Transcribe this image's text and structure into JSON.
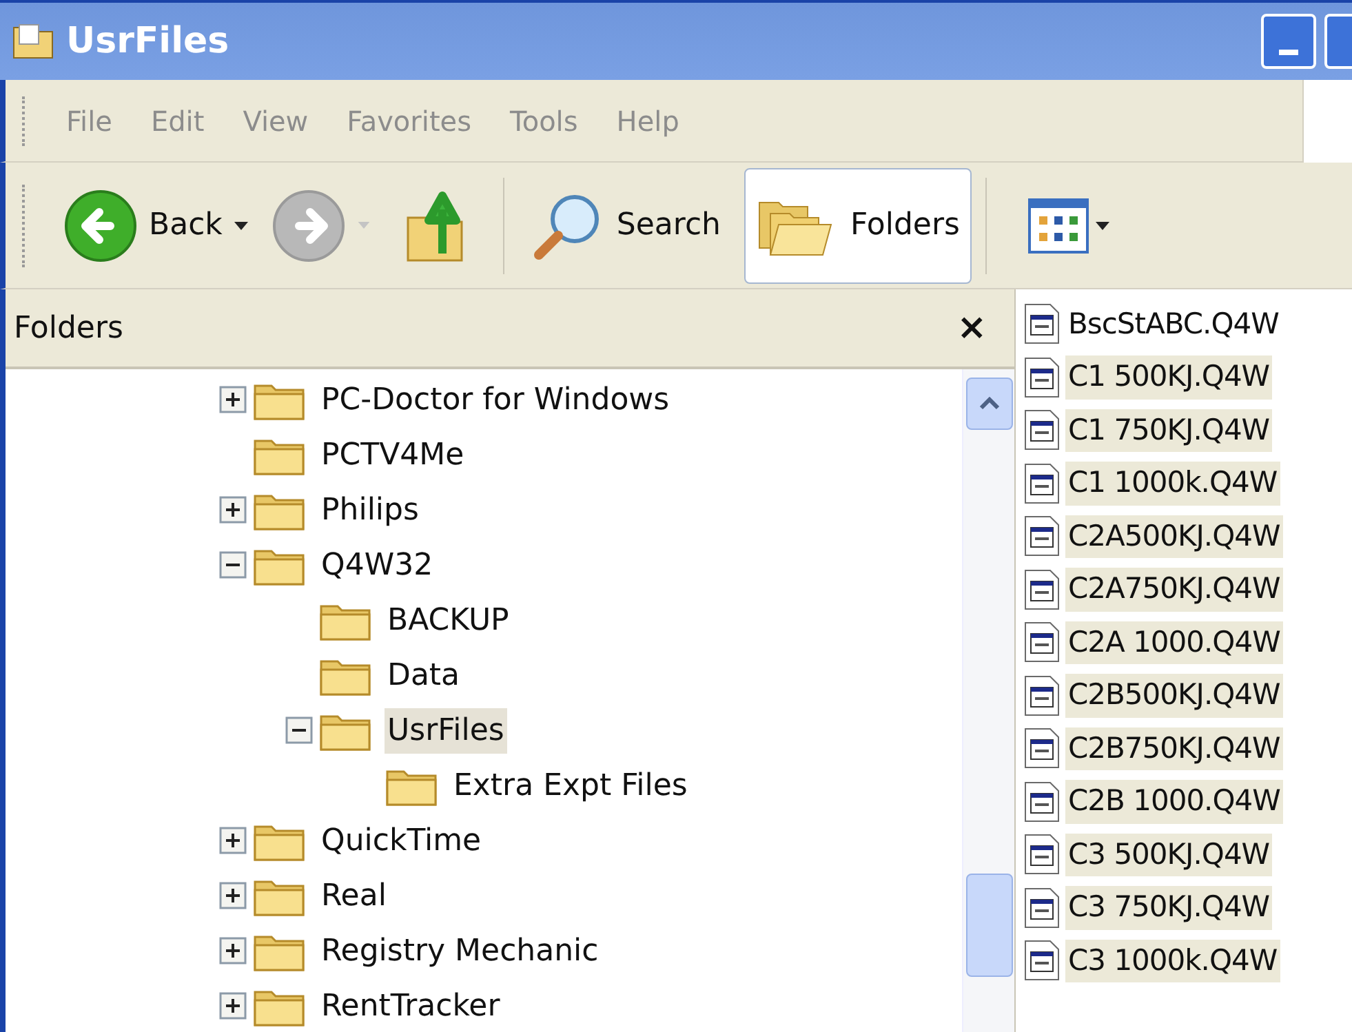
{
  "window": {
    "title": "UsrFiles"
  },
  "menu": [
    "File",
    "Edit",
    "View",
    "Favorites",
    "Tools",
    "Help"
  ],
  "toolbar": [
    {
      "kind": "back",
      "label": "Back",
      "disabled": false
    },
    {
      "kind": "forward",
      "disabled": true
    },
    {
      "kind": "up",
      "disabled": false
    },
    {
      "kind": "search",
      "label": "Search",
      "selected": false
    },
    {
      "kind": "folders",
      "label": "Folders",
      "selected": true
    },
    {
      "kind": "views",
      "disabled": false
    }
  ],
  "folders_pane": {
    "title": "Folders",
    "close": "×",
    "tree": [
      {
        "name": "PC-Doctor for Windows",
        "has_children": true,
        "expanded": false,
        "selected": false
      },
      {
        "name": "PCTV4Me",
        "has_children": false,
        "selected": false
      },
      {
        "name": "Philips",
        "has_children": true,
        "expanded": false,
        "selected": false
      },
      {
        "name": "Q4W32",
        "has_children": true,
        "expanded": true,
        "selected": false,
        "children": [
          {
            "name": "BACKUP",
            "has_children": false,
            "selected": false
          },
          {
            "name": "Data",
            "has_children": false,
            "selected": false
          },
          {
            "name": "UsrFiles",
            "has_children": true,
            "expanded": true,
            "selected": true,
            "children": [
              {
                "name": "Extra Expt Files",
                "has_children": false,
                "selected": false
              }
            ]
          }
        ]
      },
      {
        "name": "QuickTime",
        "has_children": true,
        "expanded": false,
        "selected": false
      },
      {
        "name": "Real",
        "has_children": true,
        "expanded": false,
        "selected": false
      },
      {
        "name": "Registry Mechanic",
        "has_children": true,
        "expanded": false,
        "selected": false
      },
      {
        "name": "RentTracker",
        "has_children": true,
        "expanded": false,
        "selected": false
      }
    ]
  },
  "files": [
    {
      "name": "BscStABC.Q4W",
      "selected": false
    },
    {
      "name": "C1 500KJ.Q4W",
      "selected": true
    },
    {
      "name": "C1 750KJ.Q4W",
      "selected": true
    },
    {
      "name": "C1 1000k.Q4W",
      "selected": true
    },
    {
      "name": "C2A500KJ.Q4W",
      "selected": true
    },
    {
      "name": "C2A750KJ.Q4W",
      "selected": true
    },
    {
      "name": "C2A 1000.Q4W",
      "selected": true
    },
    {
      "name": "C2B500KJ.Q4W",
      "selected": true
    },
    {
      "name": "C2B750KJ.Q4W",
      "selected": true
    },
    {
      "name": "C2B 1000.Q4W",
      "selected": true
    },
    {
      "name": "C3 500KJ.Q4W",
      "selected": true
    },
    {
      "name": "C3 750KJ.Q4W",
      "selected": true
    },
    {
      "name": "C3 1000k.Q4W",
      "selected": true
    }
  ]
}
